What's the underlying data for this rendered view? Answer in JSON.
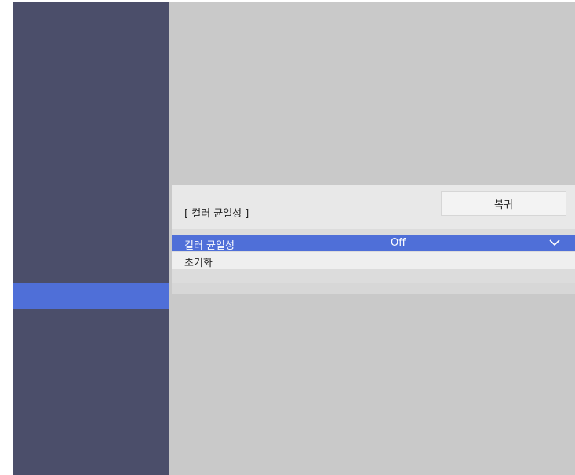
{
  "dialog": {
    "title": "[ 컬러 균일성 ]",
    "reset_label": "복귀"
  },
  "menu": {
    "items": [
      {
        "label": "컬러 균일성",
        "value": "Off",
        "selected": true
      },
      {
        "label": "초기화",
        "value": "",
        "selected": false
      }
    ]
  },
  "icons": {
    "dropdown": "chevron-down-icon"
  },
  "colors": {
    "sidebar": "#4b4e6a",
    "accent": "#4f6fd8",
    "background": "#c9c9c9",
    "panel": "#e8e8e8"
  }
}
